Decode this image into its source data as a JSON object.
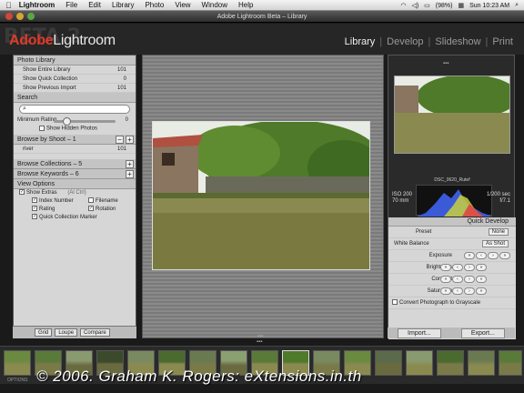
{
  "menubar": {
    "app": "Lightroom",
    "items": [
      "File",
      "Edit",
      "Library",
      "Photo",
      "View",
      "Window",
      "Help"
    ],
    "battery": "(98%)",
    "clock": "Sun 10:23 AM"
  },
  "window": {
    "title": "Adobe Lightroom Beta – Library"
  },
  "brand": {
    "adobe": "Adobe",
    "name": "Lightroom",
    "beta": "BETA 2"
  },
  "modules": [
    "Library",
    "Develop",
    "Slideshow",
    "Print"
  ],
  "library": {
    "title": "Photo Library",
    "items": [
      {
        "label": "Show Entire Library",
        "count": "101"
      },
      {
        "label": "Show Quick Collection",
        "count": "0"
      },
      {
        "label": "Show Previous Import",
        "count": "101"
      }
    ],
    "search": "Search",
    "min_rating": "Minimum Rating",
    "min_rating_val": "0",
    "show_hidden": "Show Hidden Photos",
    "browse_shoot": "Browse by Shoot – 1",
    "shoot_item": "river",
    "shoot_count": "101",
    "collections": "Browse Collections – 5",
    "keywords": "Browse Keywords – 6",
    "view_options": "View Options",
    "show_extras": "Show Extras",
    "extras_mode": "(Al Ctrl)",
    "opts": [
      [
        "Index Number",
        "Filename"
      ],
      [
        "Rating",
        "Rotation"
      ],
      [
        "Quick Collection Marker",
        ""
      ]
    ],
    "views": [
      "Grid",
      "Loupe",
      "Compare"
    ]
  },
  "right": {
    "filename": "DSC_0620_Rutef",
    "iso": "ISO 200",
    "focal": "70 mm",
    "shutter": "1/200 sec",
    "aperture": "f/7.1",
    "quick_develop": "Quick Develop",
    "preset_label": "Preset",
    "preset_val": "None",
    "wb_label": "White Balance",
    "wb_val": "As Shot",
    "adjust": [
      "Exposure",
      "Brightness",
      "Contrast",
      "Saturation"
    ],
    "grayscale": "Convert Photograph to Grayscale",
    "import": "Import...",
    "export": "Export..."
  },
  "footer": {
    "options": "OPTIONS",
    "copyright": "© 2006. Graham K. Rogers: eXtensions.in.th"
  }
}
